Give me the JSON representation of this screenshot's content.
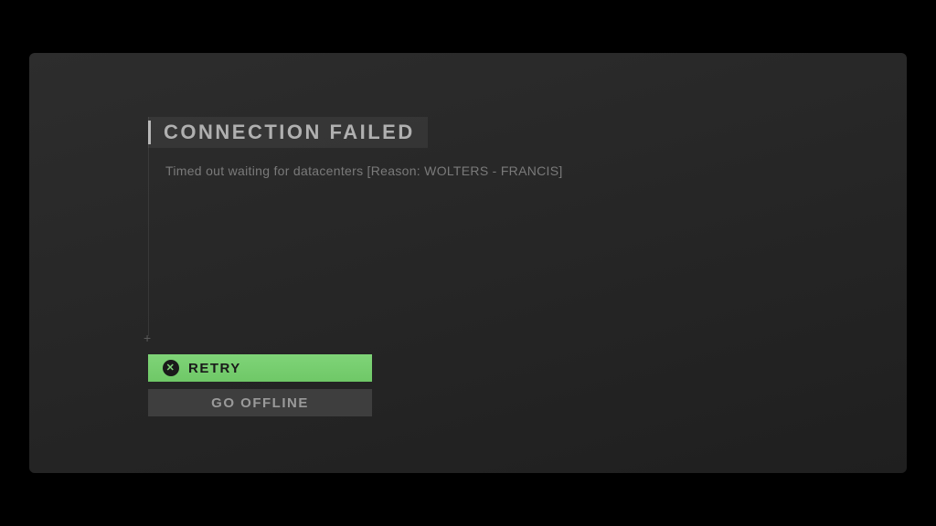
{
  "dialog": {
    "title": "CONNECTION FAILED",
    "message": "Timed out waiting for datacenters [Reason: WOLTERS - FRANCIS]"
  },
  "buttons": {
    "retry": "RETRY",
    "offline": "GO OFFLINE"
  }
}
